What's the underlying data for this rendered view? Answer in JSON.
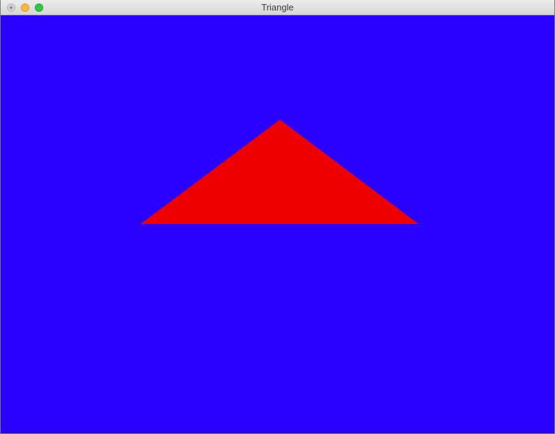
{
  "window": {
    "title": "Triangle"
  },
  "titlebar": {
    "buttons": [
      {
        "icon": "close-icon",
        "color": "#d3d3d3"
      },
      {
        "icon": "minimize-icon",
        "color": "#f5b83b"
      },
      {
        "icon": "zoom-icon",
        "color": "#33c748"
      }
    ]
  },
  "canvas": {
    "background_color": "#2a00ff",
    "shape": {
      "type": "triangle",
      "fill_color": "#ee0000"
    }
  }
}
